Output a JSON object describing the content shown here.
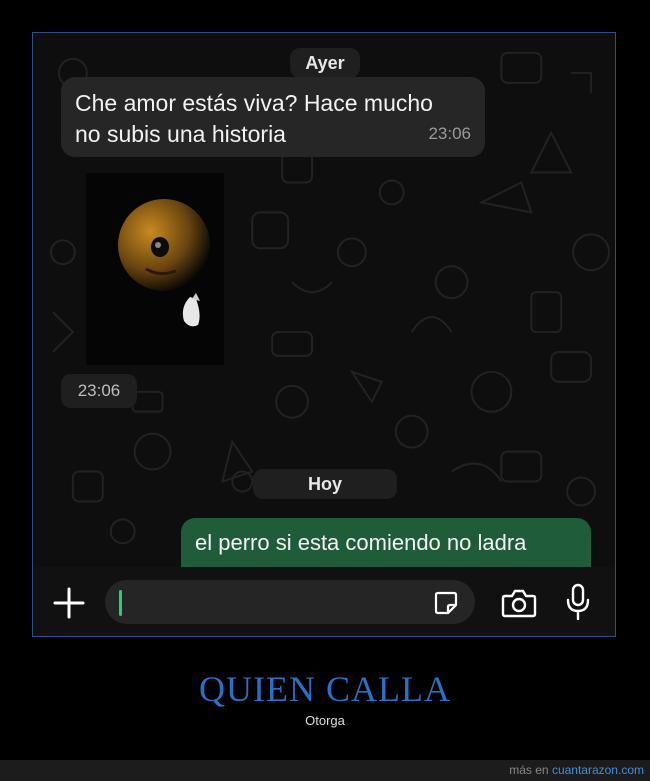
{
  "chat": {
    "date_yesterday": "Ayer",
    "incoming": {
      "text": "Che amor estás viva? Hace mucho no subis una historia",
      "time": "23:06"
    },
    "image_time": "23:06",
    "date_today": "Hoy",
    "outgoing": {
      "text": "el perro si esta comiendo no ladra"
    }
  },
  "input_bar": {
    "icons": [
      "plus-icon",
      "sticker-icon",
      "camera-icon",
      "microphone-icon"
    ]
  },
  "caption": {
    "title": "QUIEN CALLA",
    "subtitle": "Otorga"
  },
  "footer": {
    "prefix": "más en",
    "site": "cuantarazon.com"
  },
  "colors": {
    "outgoing_bubble": "#1f5c3a",
    "incoming_bubble": "#262626",
    "caption": "#2a70c4",
    "cursor": "#25d366"
  }
}
